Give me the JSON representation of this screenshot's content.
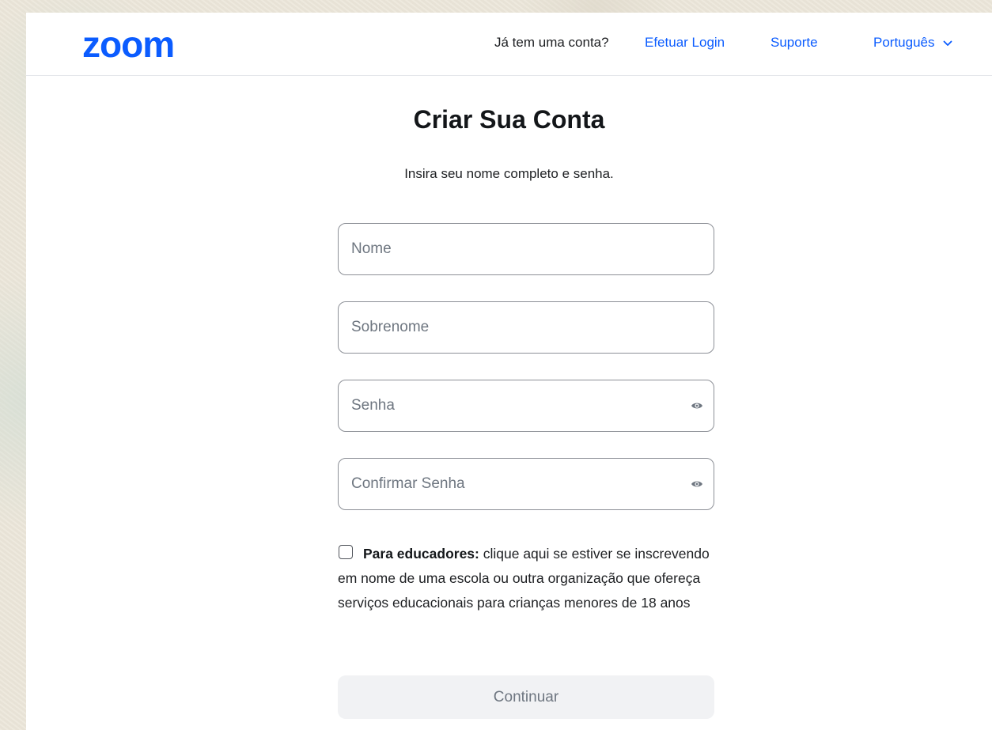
{
  "header": {
    "logo_text": "zoom",
    "account_question": "Já tem uma conta?",
    "login_link": "Efetuar Login",
    "support_link": "Suporte",
    "language_selector": "Português",
    "brand_color": "#0b5cff"
  },
  "main": {
    "title": "Criar Sua Conta",
    "subtitle": "Insira seu nome completo e senha.",
    "fields": {
      "first_name": {
        "placeholder": "Nome",
        "value": ""
      },
      "last_name": {
        "placeholder": "Sobrenome",
        "value": ""
      },
      "password": {
        "placeholder": "Senha",
        "value": "",
        "toggle_icon": "eye-icon"
      },
      "confirm_password": {
        "placeholder": "Confirmar Senha",
        "value": "",
        "toggle_icon": "eye-icon"
      }
    },
    "educator": {
      "checked": false,
      "bold_label": "Para educadores:",
      "text": " clique aqui se estiver se inscrevendo em nome de uma escola ou outra organização que ofereça serviços educacionais para crianças menores de 18 anos"
    },
    "continue_button": "Continuar"
  }
}
